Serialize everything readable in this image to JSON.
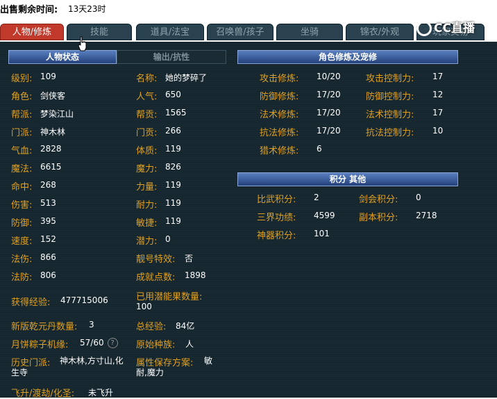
{
  "topbar": {
    "label": "出售剩余时间:",
    "value": "13天23时"
  },
  "tabs": [
    "人物/修炼",
    "技能",
    "道具/法宝",
    "召唤兽/孩子",
    "坐骑",
    "锦衣/外观",
    "玩家交易"
  ],
  "overlay": {
    "brand": "CC直播"
  },
  "left": {
    "header_active": "人物状态",
    "header_inactive": "输出/抗性",
    "col1": [
      {
        "k": "级别:",
        "v": "109"
      },
      {
        "k": "角色:",
        "v": "剑侠客"
      },
      {
        "k": "帮派:",
        "v": "梦染江山"
      },
      {
        "k": "门派:",
        "v": "神木林"
      },
      {
        "k": "气血:",
        "v": "2828"
      },
      {
        "k": "魔法:",
        "v": "6615"
      },
      {
        "k": "命中:",
        "v": "268"
      },
      {
        "k": "伤害:",
        "v": "513"
      },
      {
        "k": "防御:",
        "v": "395"
      },
      {
        "k": "速度:",
        "v": "152"
      },
      {
        "k": "法伤:",
        "v": "866"
      },
      {
        "k": "法防:",
        "v": "806"
      }
    ],
    "col2": [
      {
        "k": "名称:",
        "v": "她的梦碎了"
      },
      {
        "k": "人气:",
        "v": "650"
      },
      {
        "k": "帮贡:",
        "v": "1565"
      },
      {
        "k": "门贡:",
        "v": "266"
      },
      {
        "k": "体质:",
        "v": "119"
      },
      {
        "k": "魔力:",
        "v": "826"
      },
      {
        "k": "力量:",
        "v": "119"
      },
      {
        "k": "耐力:",
        "v": "119"
      },
      {
        "k": "敏捷:",
        "v": "119"
      },
      {
        "k": "潜力:",
        "v": "0"
      },
      {
        "k": "靓号特效:",
        "v": "否"
      },
      {
        "k": "成就点数:",
        "v": "1898"
      }
    ],
    "exp": {
      "k": "获得经验:",
      "v": "477715006"
    },
    "potion": {
      "k": "已用潜能果数量:",
      "v": "100"
    },
    "qianyuan": {
      "k": "新版乾元丹数量:",
      "v": "3"
    },
    "total_exp": {
      "k": "总经验:",
      "v": "84亿"
    },
    "mooncake": {
      "k": "月饼粽子机缘:",
      "v": "57/60"
    },
    "race": {
      "k": "原始种族:",
      "v": "人"
    },
    "history": {
      "k": "历史门派:",
      "v": "神木林,方寸山,化生寺"
    },
    "attr_save": {
      "k": "属性保存方案:",
      "v": "敏耐,魔力"
    },
    "ascend": {
      "k": "飞升/渡劫/化圣:",
      "v": "未飞升"
    }
  },
  "right": {
    "header1": "角色修炼及宠修",
    "cultivation": [
      {
        "k": "攻击修炼:",
        "v": "10/20",
        "k2": "攻击控制力:",
        "v2": "17"
      },
      {
        "k": "防御修炼:",
        "v": "17/20",
        "k2": "防御控制力:",
        "v2": "12"
      },
      {
        "k": "法术修炼:",
        "v": "17/20",
        "k2": "法术控制力:",
        "v2": "17"
      },
      {
        "k": "抗法修炼:",
        "v": "17/20",
        "k2": "抗法控制力:",
        "v2": "10"
      },
      {
        "k": "猎术修炼:",
        "v": "6",
        "k2": "",
        "v2": ""
      }
    ],
    "header2": "积分 其他",
    "points": [
      {
        "k": "比武积分:",
        "v": "2",
        "k2": "剑会积分:",
        "v2": "0"
      },
      {
        "k": "三界功绩:",
        "v": "4599",
        "k2": "副本积分:",
        "v2": "2718"
      },
      {
        "k": "神器积分:",
        "v": "101",
        "k2": "",
        "v2": ""
      }
    ]
  }
}
